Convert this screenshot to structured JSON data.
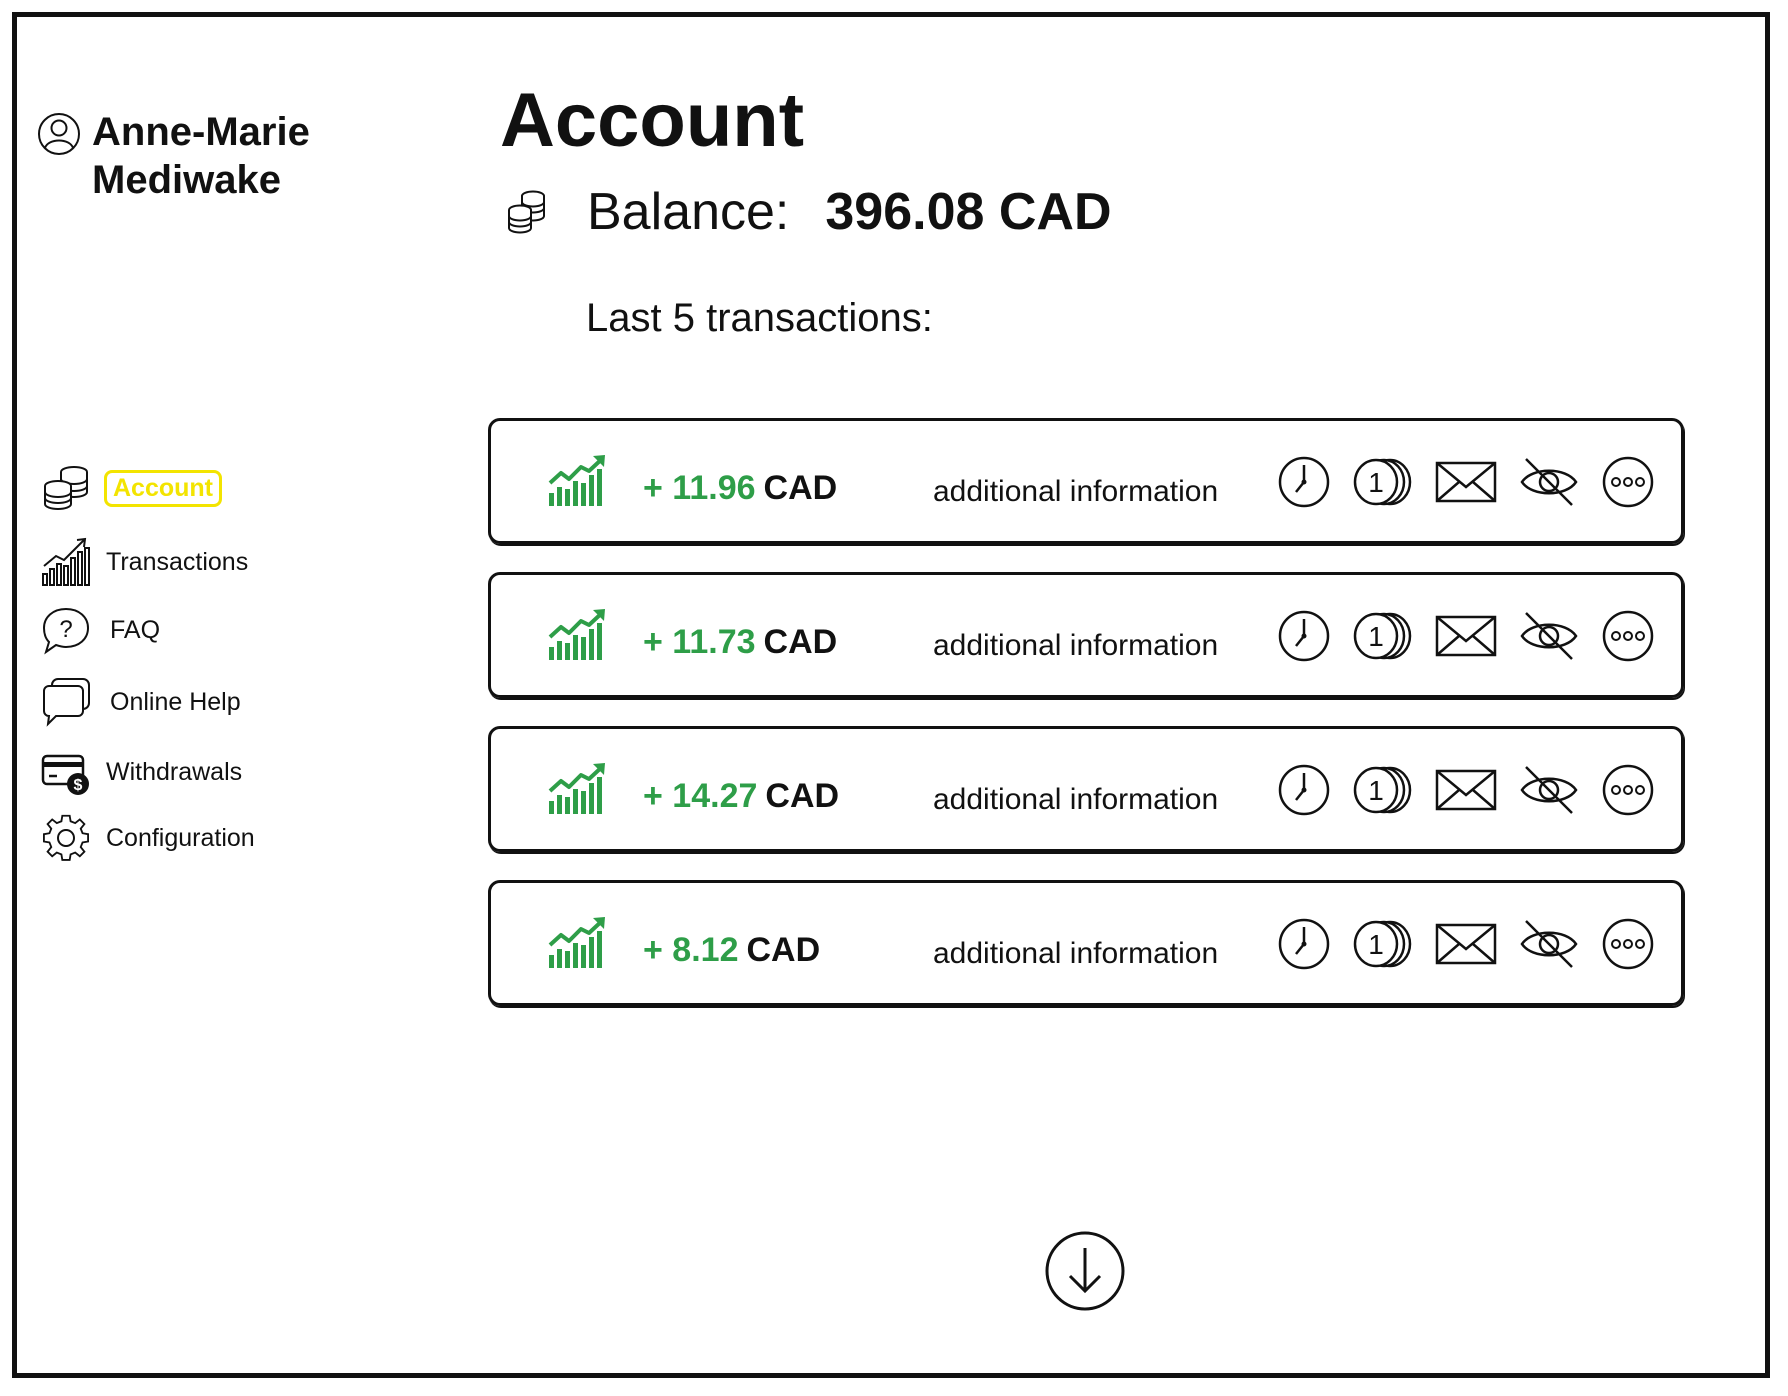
{
  "user": {
    "first_name": "Anne-Marie",
    "last_name": "Mediwake",
    "icon": "user-icon"
  },
  "sidebar": {
    "items": [
      {
        "label": "Account",
        "icon": "coins-icon",
        "active": true
      },
      {
        "label": "Transactions",
        "icon": "bar-chart-icon",
        "active": false
      },
      {
        "label": "FAQ",
        "icon": "question-icon",
        "active": false
      },
      {
        "label": "Online Help",
        "icon": "chat-icon",
        "active": false
      },
      {
        "label": "Withdrawals",
        "icon": "card-dollar-icon",
        "active": false
      },
      {
        "label": "Configuration",
        "icon": "gear-icon",
        "active": false
      }
    ]
  },
  "header": {
    "title": "Account",
    "balance_label": "Balance:",
    "balance_value": "396.08 CAD",
    "last_transactions_label": "Last 5 transactions:"
  },
  "transactions": [
    {
      "amount": "+ 11.96",
      "currency": "CAD",
      "info": "additional information"
    },
    {
      "amount": "+ 11.73",
      "currency": "CAD",
      "info": "additional information"
    },
    {
      "amount": "+ 14.27",
      "currency": "CAD",
      "info": "additional information"
    },
    {
      "amount": "+ 8.12",
      "currency": "CAD",
      "info": "additional information"
    }
  ],
  "transaction_actions": [
    "clock-icon",
    "coins-stack-icon",
    "envelope-icon",
    "eye-off-icon",
    "more-icon"
  ],
  "colors": {
    "positive": "#2e9e48",
    "active_nav": "#f3e400",
    "border": "#111111"
  }
}
